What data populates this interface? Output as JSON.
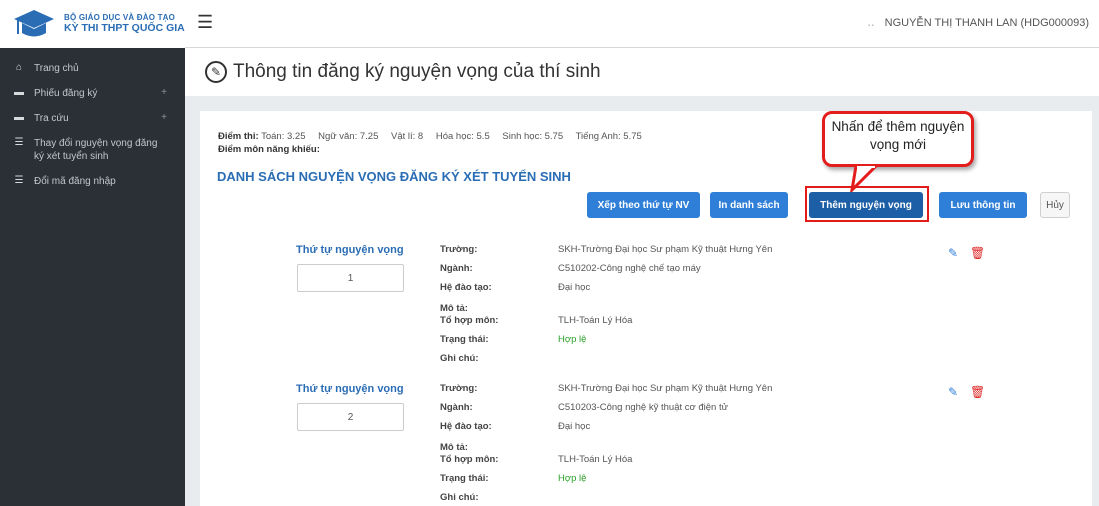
{
  "header": {
    "logo_line1": "BỘ GIÁO DỤC VÀ ĐÀO TẠO",
    "logo_line2": "KỲ THI THPT QUỐC GIA",
    "user": "NGUYỄN THỊ THANH LAN (HDG000093)"
  },
  "sidebar": {
    "items": [
      {
        "label": "Trang chủ",
        "icon": "home-icon"
      },
      {
        "label": "Phiếu đăng ký",
        "icon": "folder-icon",
        "plus": "+"
      },
      {
        "label": "Tra cứu",
        "icon": "folder-icon",
        "plus": "+"
      },
      {
        "label": "Thay đổi nguyện vọng đăng ký xét tuyển sinh",
        "icon": "list-icon"
      },
      {
        "label": "Đổi mã đăng nhập",
        "icon": "list-icon"
      }
    ]
  },
  "page": {
    "title": "Thông tin đăng ký nguyện vọng của thí sinh"
  },
  "scores": {
    "label": "Điểm thi:",
    "items": [
      "Toán: 3.25",
      "Ngữ văn: 7.25",
      "Vật lí: 8",
      "Hóa học: 5.5",
      "Sinh học: 5.75",
      "Tiếng Anh: 5.75"
    ],
    "talent_label": "Điểm môn năng khiếu:"
  },
  "list_title": "DANH SÁCH NGUYỆN VỌNG ĐĂNG KÝ XÉT TUYỂN SINH",
  "toolbar": {
    "sort": "Xếp theo thứ tự NV",
    "print": "In danh sách",
    "add": "Thêm nguyện vọng",
    "save": "Lưu thông tin",
    "cancel": "Hủy"
  },
  "tooltip": "Nhấn để thêm nguyện vọng mới",
  "field_labels": {
    "order": "Thứ tự nguyện vọng",
    "school": "Trường:",
    "major": "Ngành:",
    "mode": "Hệ đào tạo:",
    "desc": "Mô tả:",
    "combo": "Tổ hợp môn:",
    "status": "Trạng thái:",
    "note": "Ghi chú:"
  },
  "entries": [
    {
      "order": "1",
      "school": "SKH-Trường Đại học Sư phạm Kỹ thuật Hưng Yên",
      "major": "C510202-Công nghệ chế tạo máy",
      "mode": "Đại học",
      "desc": "",
      "combo": "TLH-Toán Lý Hóa",
      "status": "Hợp lệ",
      "note": ""
    },
    {
      "order": "2",
      "school": "SKH-Trường Đại học Sư phạm Kỹ thuật Hưng Yên",
      "major": "C510203-Công nghệ kỹ thuật cơ điện tử",
      "mode": "Đại học",
      "desc": "",
      "combo": "TLH-Toán Lý Hóa",
      "status": "Hợp lệ",
      "note": ""
    }
  ],
  "colors": {
    "primary": "#2f7ed8",
    "primary_dark": "#1d5fa6",
    "sidebar": "#2b3037",
    "valid": "#2aa02a",
    "highlight": "#e21b1b"
  }
}
